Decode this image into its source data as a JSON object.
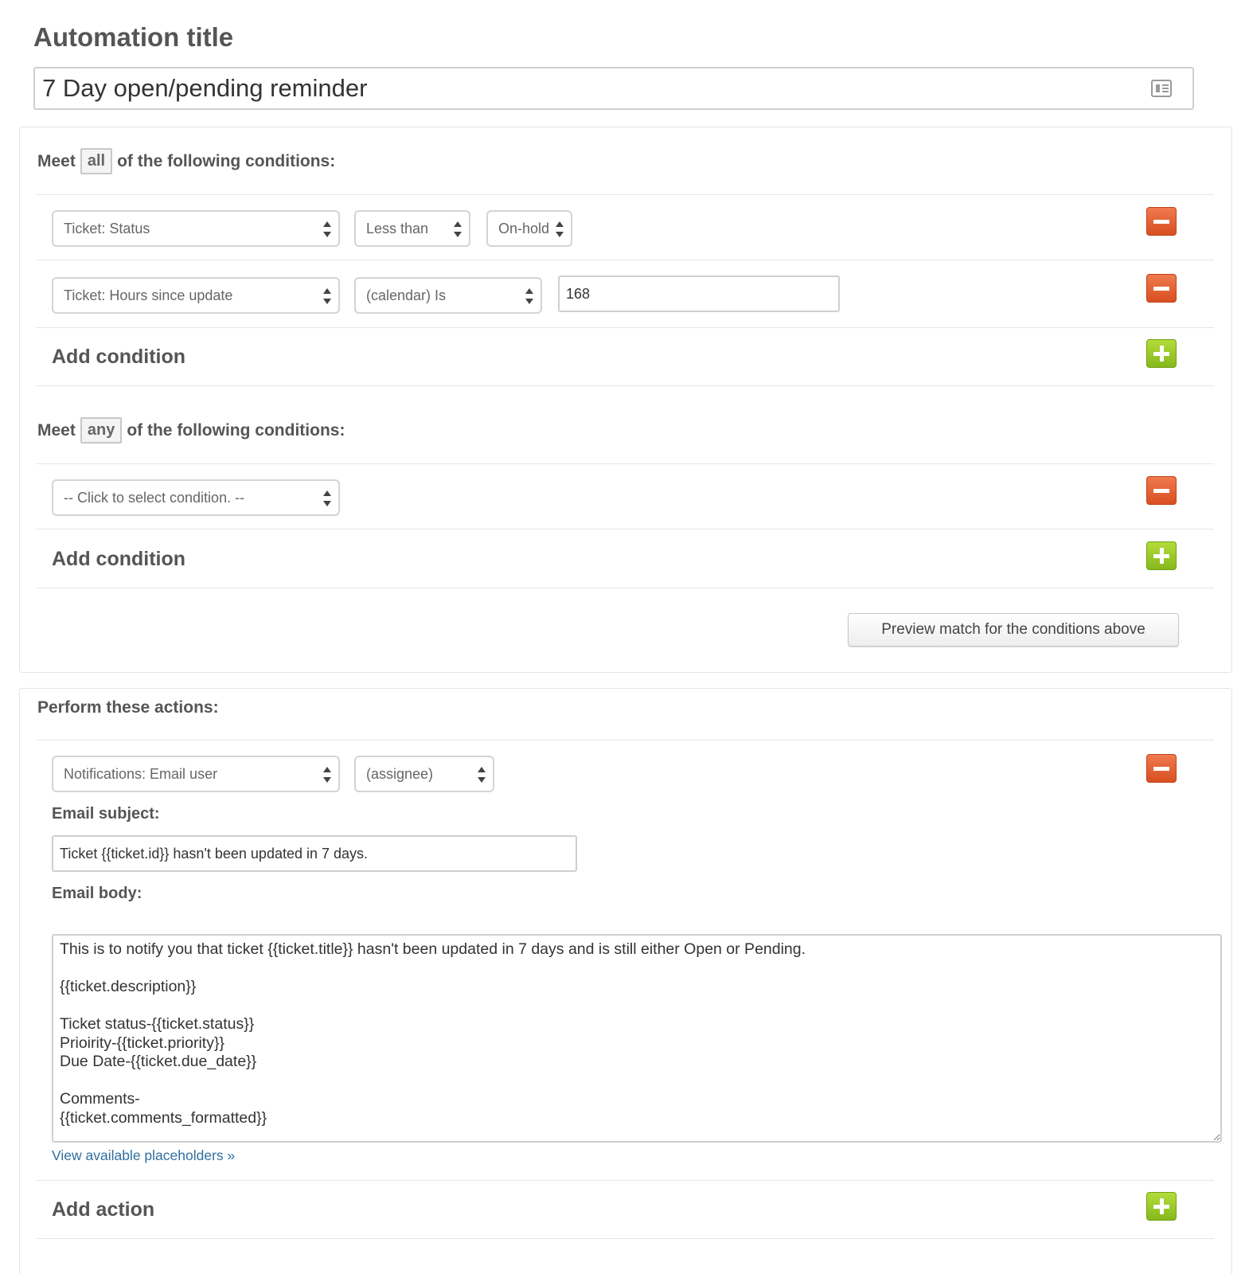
{
  "automation": {
    "title_label": "Automation title",
    "title_value": "7 Day open/pending reminder",
    "title_icon": "card-icon"
  },
  "conditions_all": {
    "prefix": "Meet",
    "mode": "all",
    "suffix": "of the following conditions:",
    "rows": [
      {
        "field": "Ticket: Status",
        "operator": "Less than",
        "value": "On-hold"
      },
      {
        "field": "Ticket: Hours since update",
        "operator": "(calendar) Is",
        "value": "168"
      }
    ],
    "add_label": "Add condition"
  },
  "conditions_any": {
    "prefix": "Meet",
    "mode": "any",
    "suffix": "of the following conditions:",
    "rows": [
      {
        "field": "-- Click to select condition. --"
      }
    ],
    "add_label": "Add condition"
  },
  "preview_button": "Preview match for the conditions above",
  "actions": {
    "heading": "Perform these actions:",
    "rows": [
      {
        "action": "Notifications: Email user",
        "target": "(assignee)"
      }
    ],
    "subject_label": "Email subject:",
    "subject_value": "Ticket {{ticket.id}} hasn't been updated in 7 days.",
    "body_label": "Email body:",
    "body_value": "This is to notify you that ticket {{ticket.title}} hasn't been updated in 7 days and is still either Open or Pending.\n\n{{ticket.description}}\n\nTicket status-{{ticket.status}}\nPrioirity-{{ticket.priority}}\nDue Date-{{ticket.due_date}}\n\nComments-\n{{ticket.comments_formatted}}",
    "placeholders_link": "View available placeholders »",
    "add_label": "Add action"
  },
  "colors": {
    "remove_button": "#e0582a",
    "add_button": "#9ccb2a",
    "link": "#2f6f9f"
  }
}
